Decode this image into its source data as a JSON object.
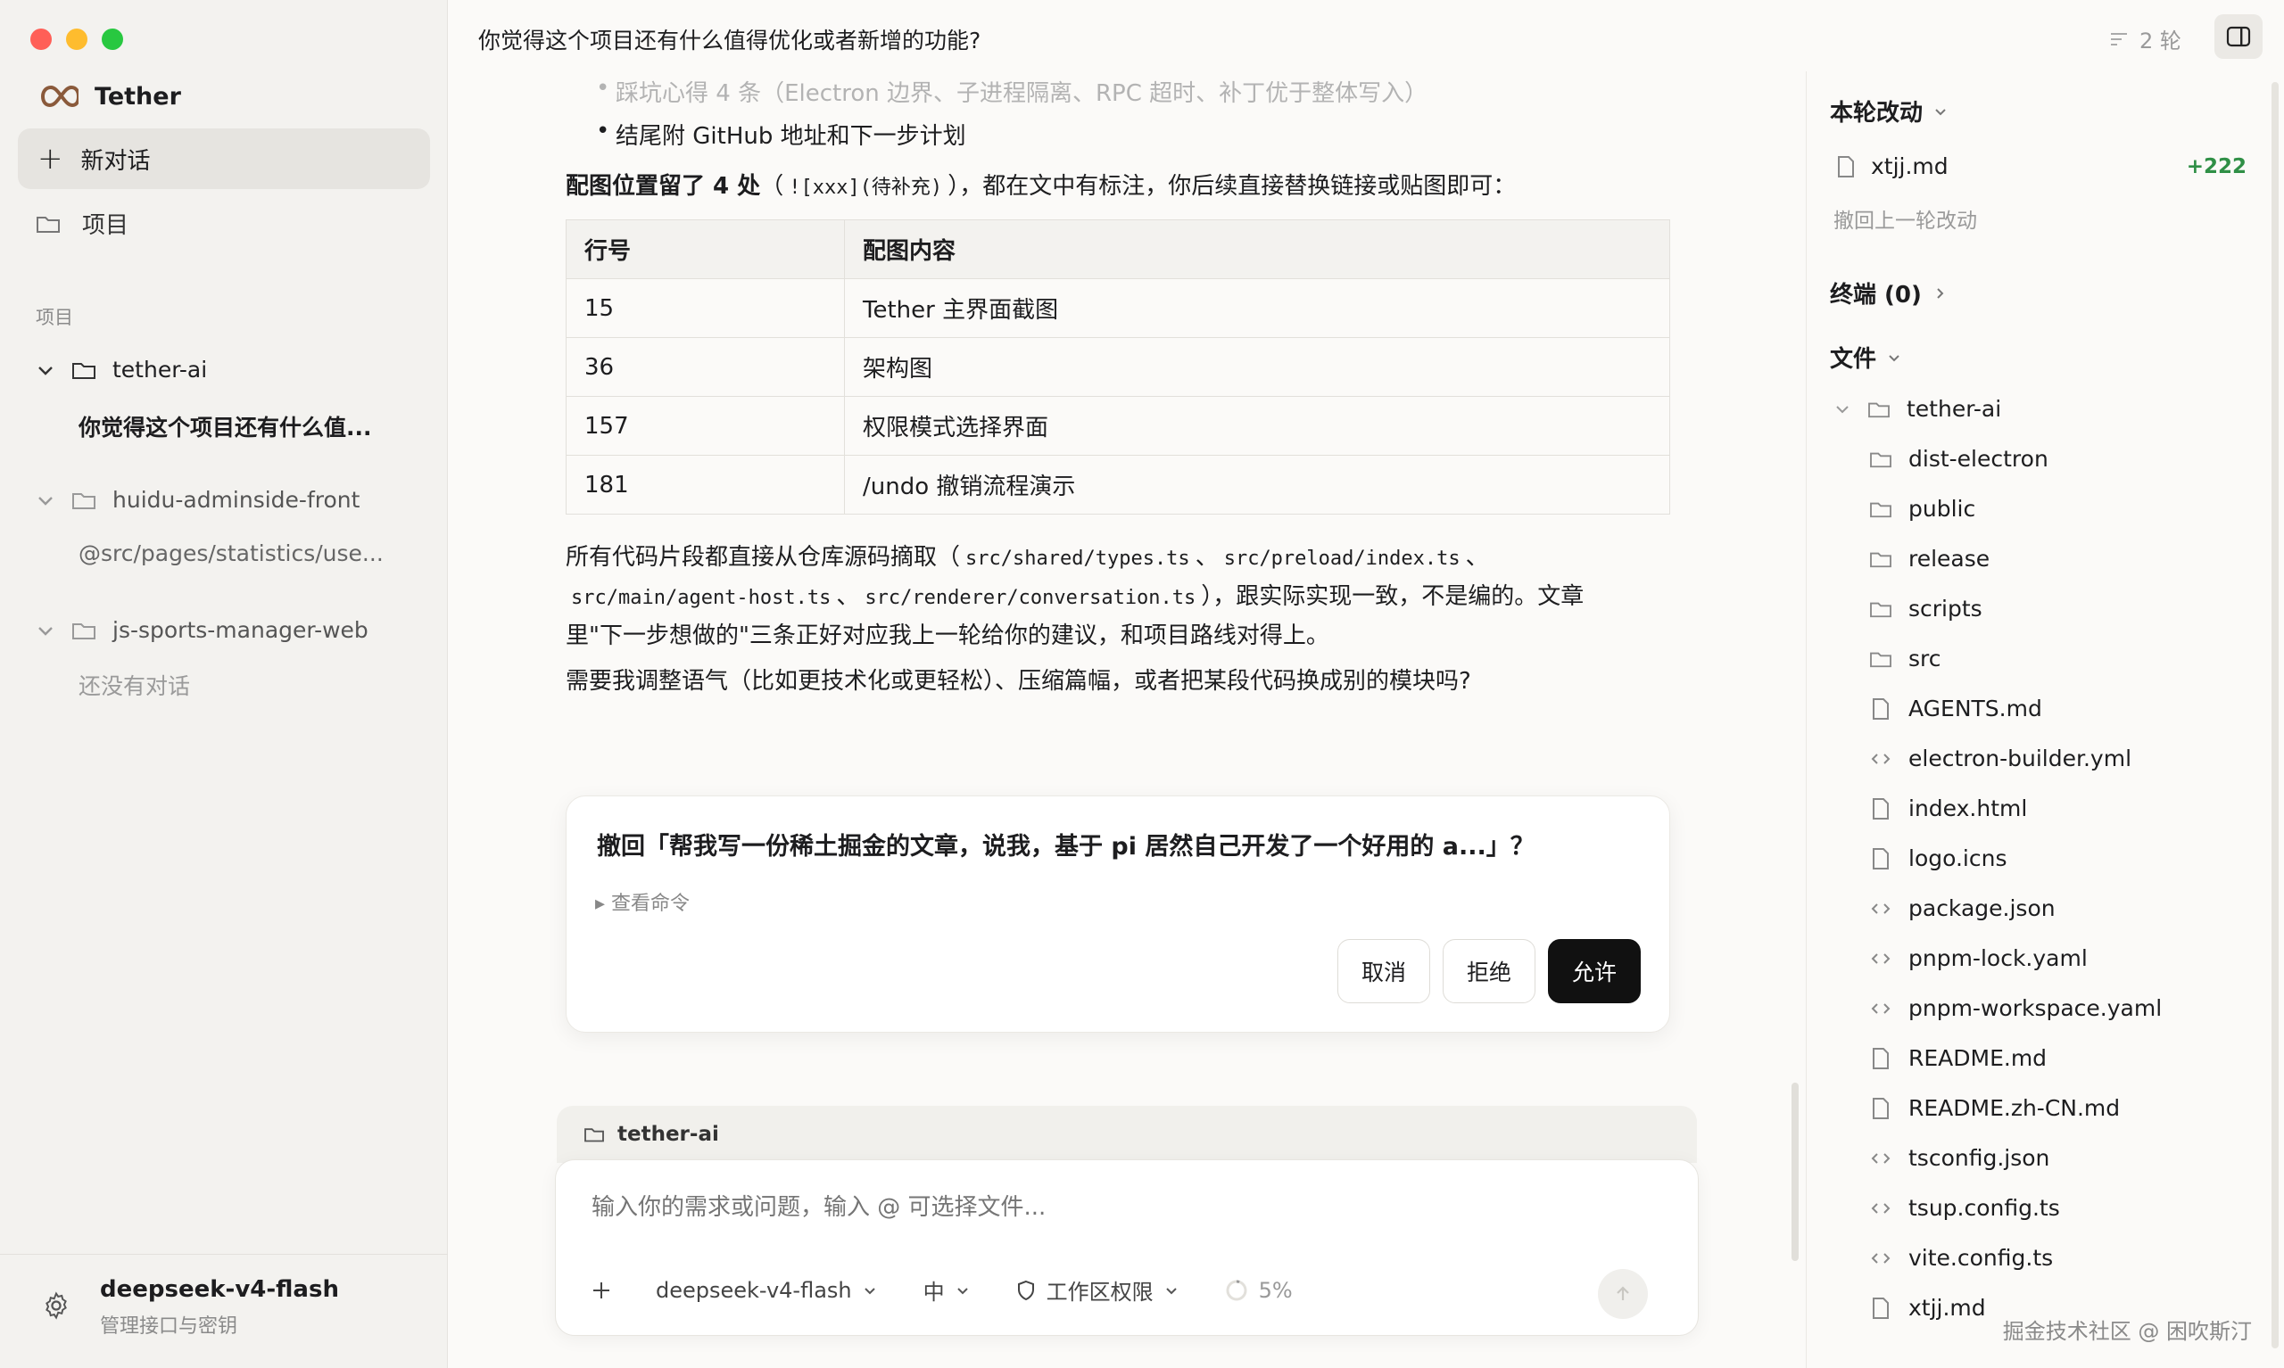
{
  "app": {
    "name": "Tether"
  },
  "sidebar": {
    "new_chat": "新对话",
    "projects_nav": "项目",
    "section_title": "项目",
    "projects": [
      {
        "name": "tether-ai",
        "expanded": true,
        "sub": "你觉得这个项目还有什么值..."
      },
      {
        "name": "huidu-adminside-front",
        "expanded": true,
        "sub": "@src/pages/statistics/use..."
      },
      {
        "name": "js-sports-manager-web",
        "expanded": true,
        "sub": "还没有对话"
      }
    ],
    "footer": {
      "model": "deepseek-v4-flash",
      "sub": "管理接口与密钥"
    }
  },
  "header": {
    "title": "你觉得这个项目还有什么值得优化或者新增的功能?",
    "rounds": "2 轮"
  },
  "content": {
    "bullet_faded": "踩坑心得 4 条（Electron 边界、子进程隔离、RPC 超时、补丁优于整体写入）",
    "bullet_last": "结尾附 GitHub 地址和下一步计划",
    "placement_bold": "配图位置留了 4 处",
    "placement_pre": "（",
    "placement_code": "![xxx](待补充)",
    "placement_post": "），都在文中有标注，你后续直接替换链接或贴图即可：",
    "table": {
      "headers": [
        "行号",
        "配图内容"
      ],
      "rows": [
        [
          "15",
          "Tether 主界面截图"
        ],
        [
          "36",
          "架构图"
        ],
        [
          "157",
          "权限模式选择界面"
        ],
        [
          "181",
          "/undo 撤销流程演示"
        ]
      ]
    },
    "code_para": {
      "t1": "所有代码片段都直接从仓库源码摘取（",
      "c1": "src/shared/types.ts",
      "s1": "、",
      "c2": "src/preload/index.ts",
      "s2": "、",
      "c3": "src/main/agent-host.ts",
      "s3": "、",
      "c4": "src/renderer/conversation.ts",
      "t2": "），跟实际实现一致，不是编的。文章",
      "t3": "里\"下一步想做的\"三条正好对应我上一轮给你的建议，和项目路线对得上。"
    },
    "question": "需要我调整语气（比如更技术化或更轻松）、压缩篇幅，或者把某段代码换成别的模块吗?"
  },
  "approval": {
    "title": "撤回「帮我写一份稀土掘金的文章，说我，基于 pi 居然自己开发了一个好用的 a...」？",
    "view_cmd": "▸ 查看命令",
    "cancel": "取消",
    "reject": "拒绝",
    "allow": "允许"
  },
  "composer": {
    "project": "tether-ai",
    "placeholder": "输入你的需求或问题，输入 @ 可选择文件...",
    "model": "deepseek-v4-flash",
    "level": "中",
    "permission": "工作区权限",
    "context": "5%"
  },
  "right_panel": {
    "changes_title": "本轮改动",
    "changed_file": "xtjj.md",
    "changed_count": "+222",
    "undo": "撤回上一轮改动",
    "terminal": "终端 (0)",
    "files_title": "文件",
    "root": "tether-ai",
    "folders": [
      "dist-electron",
      "public",
      "release",
      "scripts",
      "src"
    ],
    "files": [
      {
        "name": "AGENTS.md",
        "kind": "doc"
      },
      {
        "name": "electron-builder.yml",
        "kind": "code"
      },
      {
        "name": "index.html",
        "kind": "doc"
      },
      {
        "name": "logo.icns",
        "kind": "doc"
      },
      {
        "name": "package.json",
        "kind": "code"
      },
      {
        "name": "pnpm-lock.yaml",
        "kind": "code"
      },
      {
        "name": "pnpm-workspace.yaml",
        "kind": "code"
      },
      {
        "name": "README.md",
        "kind": "doc"
      },
      {
        "name": "README.zh-CN.md",
        "kind": "doc"
      },
      {
        "name": "tsconfig.json",
        "kind": "code"
      },
      {
        "name": "tsup.config.ts",
        "kind": "code"
      },
      {
        "name": "vite.config.ts",
        "kind": "code"
      },
      {
        "name": "xtjj.md",
        "kind": "doc"
      }
    ]
  },
  "watermark": "掘金技术社区 @ 困吹斯汀"
}
